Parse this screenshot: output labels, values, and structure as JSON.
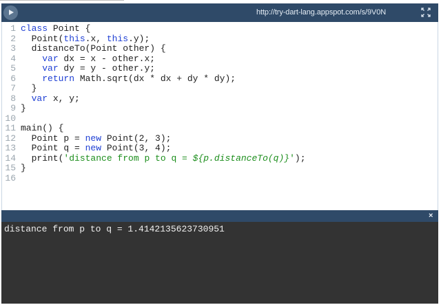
{
  "toolbar": {
    "run_icon": "play-icon",
    "url": "http://try-dart-lang.appspot.com/s/9V0N",
    "fullscreen_icon": "fullscreen-icon"
  },
  "editor": {
    "line_numbers": [
      "1",
      "2",
      "3",
      "4",
      "5",
      "6",
      "7",
      "8",
      "9",
      "10",
      "11",
      "12",
      "13",
      "14",
      "15",
      "16"
    ],
    "lines": [
      [
        "",
        "class",
        " Point {"
      ],
      [
        "  Point(",
        "this",
        ".x, ",
        "this",
        ".y);"
      ],
      [
        "  distanceTo(Point other) {"
      ],
      [
        "    ",
        "var",
        " dx = x - other.x;"
      ],
      [
        "    ",
        "var",
        " dy = y - other.y;"
      ],
      [
        "    ",
        "return",
        " Math.sqrt(dx * dx + dy * dy);"
      ],
      [
        "  }"
      ],
      [
        "  ",
        "var",
        " x, y;"
      ],
      [
        "}"
      ],
      [
        ""
      ],
      [
        "main() {"
      ],
      [
        "  Point p = ",
        "new",
        " Point(2, 3);"
      ],
      [
        "  Point q = ",
        "new",
        " Point(3, 4);"
      ],
      [
        "  print(",
        "'distance from p to q = ",
        "${p.distanceTo(q)}",
        "'",
        ");"
      ],
      [
        "}"
      ],
      [
        ""
      ]
    ],
    "colors": {
      "keyword": "#1e3fd4",
      "string": "#1c8e1c",
      "line_number": "#9aa5ae"
    }
  },
  "console": {
    "close_label": "×",
    "output": "distance from p to q = 1.4142135623730951"
  },
  "colors": {
    "bar": "#2f4a68",
    "console_bg": "#333333"
  }
}
